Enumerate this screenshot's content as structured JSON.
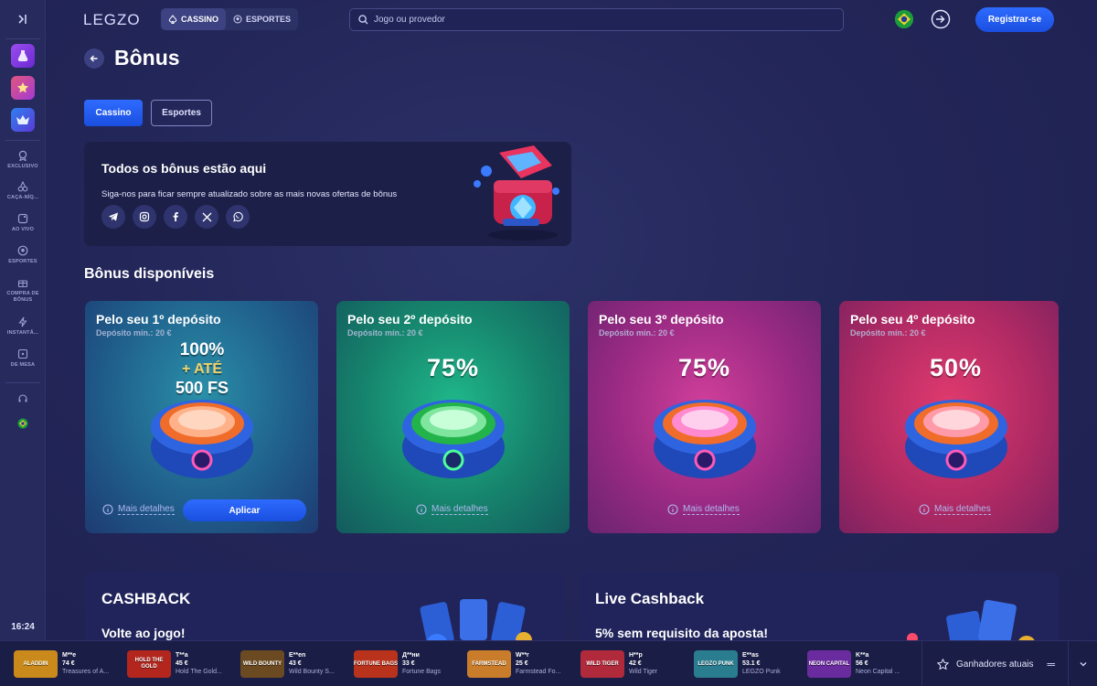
{
  "header": {
    "logo": "LEGZO",
    "tabs": [
      {
        "label": "CASSINO",
        "active": true
      },
      {
        "label": "ESPORTES",
        "active": false
      }
    ],
    "search": {
      "placeholder": "Jogo ou provedor",
      "value": ""
    },
    "register_label": "Registrar-se"
  },
  "sidebar": {
    "items": [
      {
        "label": "EXCLUSIVO",
        "icon": "award-icon"
      },
      {
        "label": "CAÇA-NÍQ...",
        "icon": "cherries-icon"
      },
      {
        "label": "AO VIVO",
        "icon": "live-icon"
      },
      {
        "label": "ESPORTES",
        "icon": "ball-icon"
      },
      {
        "label": "COMPRA DE BÔNUS",
        "icon": "gift-icon"
      },
      {
        "label": "INSTANTÂ...",
        "icon": "lightning-icon"
      },
      {
        "label": "DE MESA",
        "icon": "table-icon"
      }
    ],
    "time": "16:24"
  },
  "page": {
    "title": "Bônus",
    "category_tabs": [
      {
        "label": "Cassino",
        "active": true
      },
      {
        "label": "Esportes",
        "active": false
      }
    ]
  },
  "promo": {
    "title": "Todos os bônus estão aqui",
    "text": "Siga-nos para ficar sempre atualizado sobre as mais novas ofertas de bônus",
    "socials": [
      "telegram-icon",
      "instagram-icon",
      "facebook-icon",
      "x-icon",
      "whatsapp-icon"
    ]
  },
  "bonuses": {
    "section_title": "Bônus disponíveis",
    "more_label": "Mais detalhes",
    "apply_label": "Aplicar",
    "cards": [
      {
        "title": "Pelo seu 1º depósito",
        "min": "Depósito mín.: 20 €",
        "line1": "100%",
        "line2": "+ ATÉ",
        "line3": "500 FS"
      },
      {
        "title": "Pelo seu 2º depósito",
        "min": "Depósito mín.: 20 €",
        "percent": "75%"
      },
      {
        "title": "Pelo seu 3º depósito",
        "min": "Depósito mín.: 20 €",
        "percent": "75%"
      },
      {
        "title": "Pelo seu 4º depósito",
        "min": "Depósito mín.: 20 €",
        "percent": "50%"
      }
    ]
  },
  "cashback": [
    {
      "title": "CASHBACK",
      "subtitle": "Volte ao jogo!"
    },
    {
      "title": "Live Cashback",
      "subtitle": "5% sem requisito da aposta!"
    }
  ],
  "winners": {
    "button_label": "Ganhadores atuais",
    "items": [
      {
        "name": "M**e",
        "amount": "74 €",
        "game": "Treasures of A...",
        "thumb": "ALADDIN",
        "color": "#c98a1b"
      },
      {
        "name": "T**a",
        "amount": "45 €",
        "game": "Hold The Gold...",
        "thumb": "HOLD THE GOLD",
        "color": "#b3261e"
      },
      {
        "name": "E**en",
        "amount": "43 €",
        "game": "Wild Bounty S...",
        "thumb": "WILD BOUNTY",
        "color": "#6b4a22"
      },
      {
        "name": "Д**ни",
        "amount": "33 €",
        "game": "Fortune Bags",
        "thumb": "FORTUNE BAGS",
        "color": "#b8321c"
      },
      {
        "name": "W**r",
        "amount": "25 €",
        "game": "Farmstead Fo...",
        "thumb": "FARMSTEAD",
        "color": "#c97d2a"
      },
      {
        "name": "H**p",
        "amount": "42 €",
        "game": "Wild Tiger",
        "thumb": "WILD TIGER",
        "color": "#b02a3c"
      },
      {
        "name": "E**as",
        "amount": "53.1 €",
        "game": "LEGZO Punk",
        "thumb": "LEGZO PUNK",
        "color": "#2a7c8f"
      },
      {
        "name": "K**a",
        "amount": "56 €",
        "game": "Neon Capital ...",
        "thumb": "NEON CAPITAL",
        "color": "#6a2b9e"
      }
    ]
  },
  "colors": {
    "accent": "#2e6bff",
    "background": "#232658",
    "sidebar": "#262a5c"
  }
}
